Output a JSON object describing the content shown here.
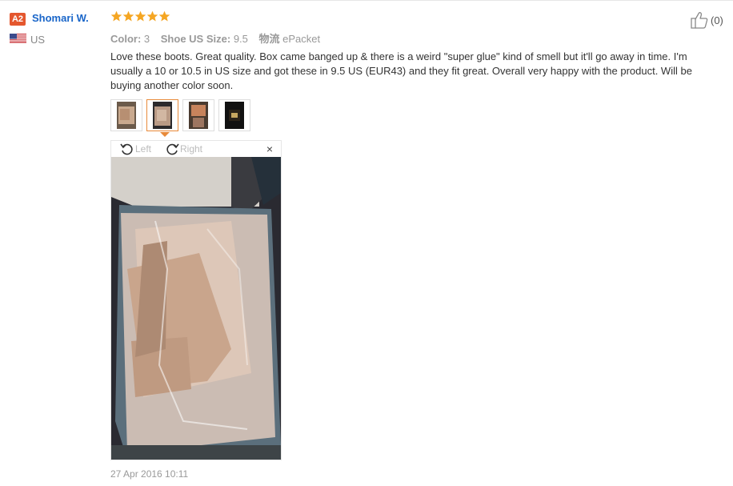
{
  "user": {
    "badge": "A2",
    "name": "Shomari W.",
    "country": "US",
    "flag_icon": "us-flag-icon"
  },
  "rating": {
    "stars": 5,
    "max": 5,
    "color": "#f5a623"
  },
  "attributes": [
    {
      "key": "Color:",
      "value": "3"
    },
    {
      "key": "Shoe US Size:",
      "value": "9.5"
    },
    {
      "key": "物流",
      "value": "ePacket"
    }
  ],
  "helpful": {
    "icon": "thumbs-up-icon",
    "count": "(0)"
  },
  "review_text": "Love these boots. Great quality. Box came banged up & there is a weird \"super glue\" kind of smell but it'll go away in time. I'm usually a 10 or 10.5 in US size and got these in 9.5 US (EUR43) and they fit great. Overall very happy with the product. Will be buying another color soon.",
  "thumbnails": [
    {
      "name": "review-photo-1",
      "selected": false
    },
    {
      "name": "review-photo-2",
      "selected": true
    },
    {
      "name": "review-photo-3",
      "selected": false
    },
    {
      "name": "review-photo-4",
      "selected": false
    }
  ],
  "viewer": {
    "rotate_left": "Left",
    "rotate_right": "Right",
    "close": "×"
  },
  "date": "27 Apr 2016 10:11",
  "colors": {
    "link": "#1a66c9",
    "badge": "#e4572e",
    "accent": "#e88a3a"
  }
}
